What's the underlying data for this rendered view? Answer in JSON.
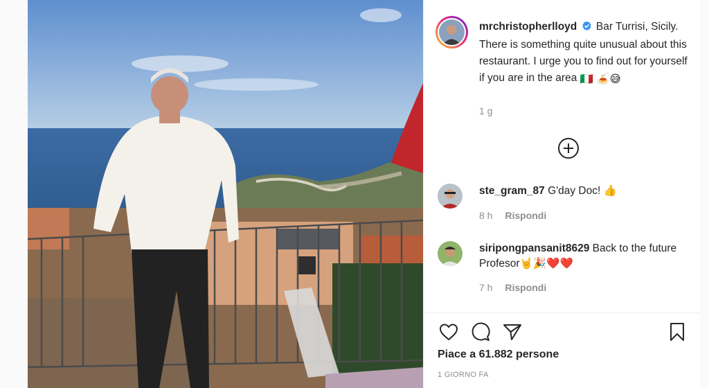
{
  "post": {
    "image_alt": "photo",
    "author": {
      "username": "mrchristopherlloyd",
      "verified_icon": "verified-badge-icon"
    },
    "caption": "Bar Turrisi, Sicily. There is something quite unusual about this restaurant. I urge you to find out for yourself if you are in the area",
    "caption_emojis": "🇮🇹 🍝😅",
    "time_ago": "1 g",
    "load_more_icon": "plus-circle-icon",
    "comments": [
      {
        "username": "ste_gram_87",
        "text": "G'day Doc! 👍",
        "time": "8 h",
        "reply_label": "Rispondi"
      },
      {
        "username": "siripongpansanit8629",
        "text": "Back to the future Profesor🤘🎉❤️❤️",
        "time": "7 h",
        "reply_label": "Rispondi"
      }
    ],
    "likes_text": "Piace a 61.882 persone",
    "date_text": "1 GIORNO FA",
    "colors": {
      "text": "#262626",
      "secondary": "#8e8e8e",
      "verified": "#3897f0",
      "border": "#efefef"
    }
  }
}
